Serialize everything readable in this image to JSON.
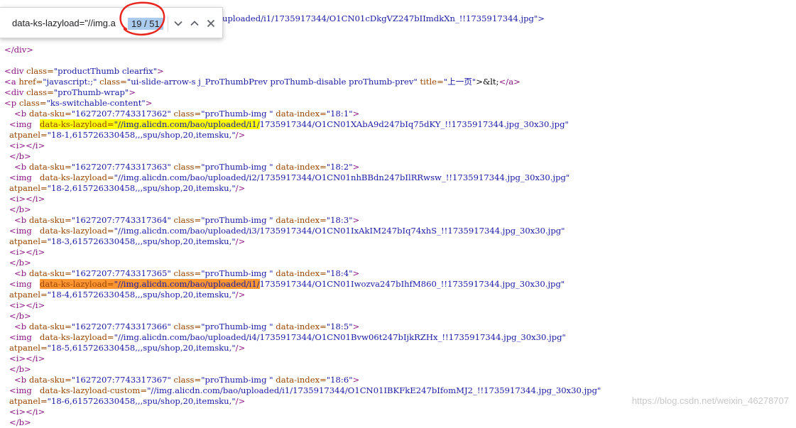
{
  "find_bar": {
    "query": "data-ks-lazyload=\"//img.a",
    "match_count": "19 / 51"
  },
  "code": {
    "l0": "uploaded/i1/1735917344/O1CN01cDkgVZ247bIImdkXn_!!1735917344.jpg\">",
    "l1": "</div>",
    "l2_tag": "<div ",
    "l2_attr": "class=",
    "l2_val": "\"productThumb clearfix\"",
    "l2_end": ">",
    "l3_a": "<a ",
    "l3_href": "href=",
    "l3_hrefval": "\"javascript:;\"",
    "l3_class": " class=",
    "l3_classval": "\"ui-slide-arrow-s j_ProThumbPrev proThumb-disable proThumb-prev\"",
    "l3_title": " title=",
    "l3_titleval": "\"上一页\"",
    "l3_rest": ">&lt;",
    "l3_close": "</a>",
    "l4_tag": "<div ",
    "l4_attr": "class=",
    "l4_val": "\"proThumb-wrap\"",
    "l4_end": ">",
    "l5_tag": "<p ",
    "l5_attr": "class=",
    "l5_val": "\"ks-switchable-content\"",
    "l5_end": ">",
    "items": [
      {
        "sku": "\"1627207:7743317362\"",
        "index": "\"18:1\"",
        "attr": "data-ks-lazyload=",
        "prefix": "\"//img.alicdn.com/bao/uploaded/i1/",
        "suffix": "1735917344/O1CN01XAbA9d247bIq75dKY_!!1735917344.jpg_30x30.jpg\"",
        "atpanel": "\"18-1,615726330458,,,spu/shop,20,itemsku,\""
      },
      {
        "sku": "\"1627207:7743317363\"",
        "index": "\"18:2\"",
        "attr": "data-ks-lazyload=",
        "prefix": "\"//img.alicdn.com/bao/uploaded/i2/",
        "suffix": "1735917344/O1CN01nhBBdn247bIlRRwsw_!!1735917344.jpg_30x30.jpg\"",
        "atpanel": "\"18-2,615726330458,,,spu/shop,20,itemsku,\""
      },
      {
        "sku": "\"1627207:7743317364\"",
        "index": "\"18:3\"",
        "attr": "data-ks-lazyload=",
        "prefix": "\"//img.alicdn.com/bao/uploaded/i3/",
        "suffix": "1735917344/O1CN01IxAkIM247bIq74xhS_!!1735917344.jpg_30x30.jpg\"",
        "atpanel": "\"18-3,615726330458,,,spu/shop,20,itemsku,\""
      },
      {
        "sku": "\"1627207:7743317365\"",
        "index": "\"18:4\"",
        "attr": "data-ks-lazyload=",
        "prefix": "\"//img.alicdn.com/bao/uploaded/i1/",
        "suffix": "1735917344/O1CN01Iwozva247bIhfM860_!!1735917344.jpg_30x30.jpg\"",
        "atpanel": "\"18-4,615726330458,,,spu/shop,20,itemsku,\""
      },
      {
        "sku": "\"1627207:7743317366\"",
        "index": "\"18:5\"",
        "attr": "data-ks-lazyload=",
        "prefix": "\"//img.alicdn.com/bao/uploaded/i4/",
        "suffix": "1735917344/O1CN01Bvw06t247bIjkRZHx_!!1735917344.jpg_30x30.jpg\"",
        "atpanel": "\"18-5,615726330458,,,spu/shop,20,itemsku,\""
      },
      {
        "sku": "\"1627207:7743317367\"",
        "index": "\"18:6\"",
        "attr": "data-ks-lazyload-custom=",
        "prefix": "\"//img.alicdn.com/bao/uploaded/i1/",
        "suffix": "1735917344/O1CN01IBKFkE247bIfomMJ2_!!1735917344.jpg_30x30.jpg\"",
        "atpanel": "\"18-6,615726330458,,,spu/shop,20,itemsku,\""
      }
    ],
    "b_open": "<b ",
    "sku_attr": "data-sku=",
    "class_attr": " class=",
    "class_val": "\"proThumb-img \"",
    "index_attr": " data-index=",
    "img_tag": "<img ",
    "atpanel_attr": "atpanel=",
    "self_close": "/>",
    "i_line": "<i></i>",
    "b_close": "</b>",
    "gt": ">"
  },
  "watermark": "https://blog.csdn.net/weixin_46278707",
  "colors": {
    "tag": "#881280",
    "attr": "#994500",
    "value": "#1a1aa6",
    "highlight_current": "#ff9632",
    "highlight_match": "#ffff00",
    "count_bg": "#aacbee"
  }
}
